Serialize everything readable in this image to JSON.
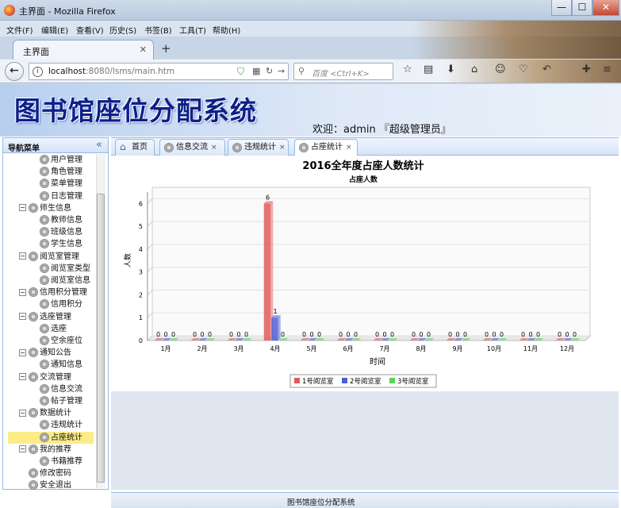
{
  "window": {
    "title": "主界面 - Mozilla Firefox",
    "minimize": "—",
    "maximize": "☐",
    "close": "✕"
  },
  "menubar": [
    "文件(F)",
    "编辑(E)",
    "查看(V)",
    "历史(S)",
    "书签(B)",
    "工具(T)",
    "帮助(H)"
  ],
  "browser_tab": {
    "label": "主界面",
    "close": "✕",
    "new": "+"
  },
  "address": {
    "host": "localhost",
    "path": ":8080/lsms/main.htm",
    "info": "i"
  },
  "search": {
    "placeholder": "百度 <Ctrl+K>",
    "icon": "search-icon"
  },
  "banner": {
    "title": "图书馆座位分配系统",
    "welcome": "欢迎：admin 『超级管理员』"
  },
  "nav": {
    "title": "导航菜单",
    "collapse": "«",
    "items": [
      {
        "label": "用户管理",
        "level": 2
      },
      {
        "label": "角色管理",
        "level": 2
      },
      {
        "label": "菜单管理",
        "level": 2
      },
      {
        "label": "日志管理",
        "level": 2
      },
      {
        "label": "师生信息",
        "level": 1
      },
      {
        "label": "教师信息",
        "level": 2
      },
      {
        "label": "班级信息",
        "level": 2
      },
      {
        "label": "学生信息",
        "level": 2
      },
      {
        "label": "阅览室管理",
        "level": 1
      },
      {
        "label": "阅览室类型",
        "level": 2
      },
      {
        "label": "阅览室信息",
        "level": 2
      },
      {
        "label": "信用积分管理",
        "level": 1
      },
      {
        "label": "信用积分",
        "level": 2
      },
      {
        "label": "选座管理",
        "level": 1
      },
      {
        "label": "选座",
        "level": 2
      },
      {
        "label": "空余座位",
        "level": 2
      },
      {
        "label": "通知公告",
        "level": 1
      },
      {
        "label": "通知信息",
        "level": 2
      },
      {
        "label": "交流管理",
        "level": 1
      },
      {
        "label": "信息交流",
        "level": 2
      },
      {
        "label": "帖子管理",
        "level": 2
      },
      {
        "label": "数据统计",
        "level": 1
      },
      {
        "label": "违规统计",
        "level": 2
      },
      {
        "label": "占座统计",
        "level": 2,
        "selected": true
      },
      {
        "label": "我的推荐",
        "level": 1
      },
      {
        "label": "书籍推荐",
        "level": 2
      },
      {
        "label": "修改密码",
        "level": 1
      },
      {
        "label": "安全退出",
        "level": 1
      }
    ]
  },
  "page_tabs": [
    {
      "label": "首页",
      "close": ""
    },
    {
      "label": "信息交流",
      "close": "×"
    },
    {
      "label": "违规统计",
      "close": "×"
    },
    {
      "label": "占座统计",
      "close": "×",
      "active": true
    }
  ],
  "chart_data": {
    "type": "bar",
    "title": "2016全年度占座人数统计",
    "subtitle": "占座人数",
    "xlabel": "时间",
    "ylabel": "人数",
    "ylim": [
      0,
      6.5
    ],
    "yticks": [
      "0",
      "1",
      "2",
      "3",
      "4",
      "5",
      "6"
    ],
    "categories": [
      "1月",
      "2月",
      "3月",
      "4月",
      "5月",
      "6月",
      "7月",
      "8月",
      "9月",
      "10月",
      "11月",
      "12月"
    ],
    "series": [
      {
        "name": "1号阅览室",
        "color": "#e05a5a",
        "values": [
          0,
          0,
          0,
          6,
          0,
          0,
          0,
          0,
          0,
          0,
          0,
          0
        ]
      },
      {
        "name": "2号阅览室",
        "color": "#4d5fd6",
        "values": [
          0,
          0,
          0,
          1,
          0,
          0,
          0,
          0,
          0,
          0,
          0,
          0
        ]
      },
      {
        "name": "3号阅览室",
        "color": "#5ad35a",
        "values": [
          0,
          0,
          0,
          0,
          0,
          0,
          0,
          0,
          0,
          0,
          0,
          0
        ]
      }
    ],
    "legend": "bottom",
    "grid": true
  },
  "footer": "图书馆座位分配系统"
}
